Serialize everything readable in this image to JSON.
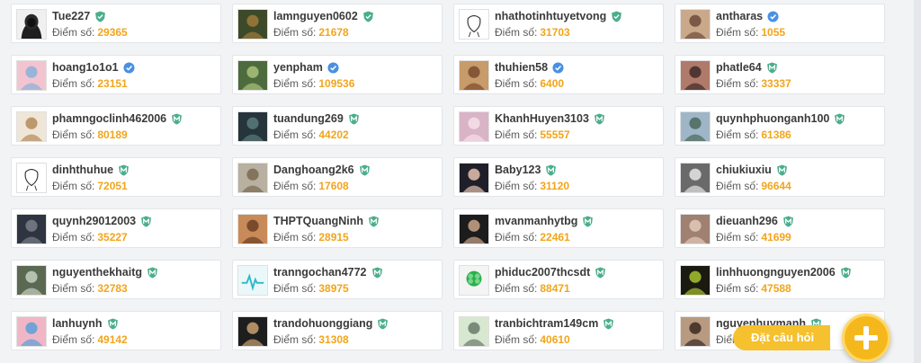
{
  "score_label": "Điểm số:",
  "ask_button_label": "Đặt câu hỏi",
  "colors": {
    "accent": "#f2a51a",
    "badge_blue": "#4a90e2",
    "badge_green": "#4cae8c",
    "fab": "#f5b81c"
  },
  "users": [
    {
      "name": "Tue227",
      "score": "29365",
      "badge": "green-shield-check-icon",
      "avatar": "anonymous-hacker"
    },
    {
      "name": "lamnguyen0602",
      "score": "21678",
      "badge": "green-shield-check-icon",
      "avatar": "photo"
    },
    {
      "name": "nhathotinhtuyetvong",
      "score": "31703",
      "badge": "green-shield-check-icon",
      "avatar": "sketch"
    },
    {
      "name": "antharas",
      "score": "1055",
      "badge": "blue-verified-icon",
      "avatar": "photo"
    },
    {
      "name": "hoang1o1o1",
      "score": "23151",
      "badge": "blue-verified-icon",
      "avatar": "photo"
    },
    {
      "name": "yenpham",
      "score": "109536",
      "badge": "blue-verified-icon",
      "avatar": "photo"
    },
    {
      "name": "thuhien58",
      "score": "6400",
      "badge": "blue-verified-icon",
      "avatar": "photo"
    },
    {
      "name": "phatle64",
      "score": "33337",
      "badge": "green-shield-m-icon",
      "avatar": "photo"
    },
    {
      "name": "phamngoclinh462006",
      "score": "80189",
      "badge": "green-shield-m-icon",
      "avatar": "photo"
    },
    {
      "name": "tuandung269",
      "score": "44202",
      "badge": "green-shield-m-icon",
      "avatar": "photo"
    },
    {
      "name": "KhanhHuyen3103",
      "score": "55557",
      "badge": "green-shield-m-icon",
      "avatar": "photo"
    },
    {
      "name": "quynhphuonganh100",
      "score": "61386",
      "badge": "green-shield-m-icon",
      "avatar": "photo"
    },
    {
      "name": "dinhthuhue",
      "score": "72051",
      "badge": "green-shield-m-icon",
      "avatar": "sketch"
    },
    {
      "name": "Danghoang2k6",
      "score": "17608",
      "badge": "green-shield-m-icon",
      "avatar": "photo"
    },
    {
      "name": "Baby123",
      "score": "31120",
      "badge": "green-shield-m-icon",
      "avatar": "photo"
    },
    {
      "name": "chiukiuxiu",
      "score": "96644",
      "badge": "green-shield-m-icon",
      "avatar": "photo"
    },
    {
      "name": "quynh29012003",
      "score": "35227",
      "badge": "green-shield-m-icon",
      "avatar": "photo"
    },
    {
      "name": "THPTQuangNinh",
      "score": "28915",
      "badge": "green-shield-m-icon",
      "avatar": "photo"
    },
    {
      "name": "mvanmanhytbg",
      "score": "22461",
      "badge": "green-shield-m-icon",
      "avatar": "photo"
    },
    {
      "name": "dieuanh296",
      "score": "41699",
      "badge": "green-shield-m-icon",
      "avatar": "photo"
    },
    {
      "name": "nguyenthekhaitg",
      "score": "32783",
      "badge": "green-shield-m-icon",
      "avatar": "photo"
    },
    {
      "name": "tranngochan4772",
      "score": "38975",
      "badge": "green-shield-m-icon",
      "avatar": "heartbeat"
    },
    {
      "name": "phiduc2007thcsdt",
      "score": "88471",
      "badge": "green-shield-m-icon",
      "avatar": "clover"
    },
    {
      "name": "linhhuongnguyen2006",
      "score": "47588",
      "badge": "green-shield-m-icon",
      "avatar": "photo"
    },
    {
      "name": "lanhuynh",
      "score": "49142",
      "badge": "green-shield-m-icon",
      "avatar": "photo"
    },
    {
      "name": "trandohuonggiang",
      "score": "31308",
      "badge": "green-shield-m-icon",
      "avatar": "photo"
    },
    {
      "name": "tranbichtram149cm",
      "score": "40610",
      "badge": "green-shield-m-icon",
      "avatar": "photo"
    },
    {
      "name": "nguyenhuymanh",
      "score": "",
      "badge": "green-shield-m-icon",
      "avatar": "photo"
    }
  ]
}
